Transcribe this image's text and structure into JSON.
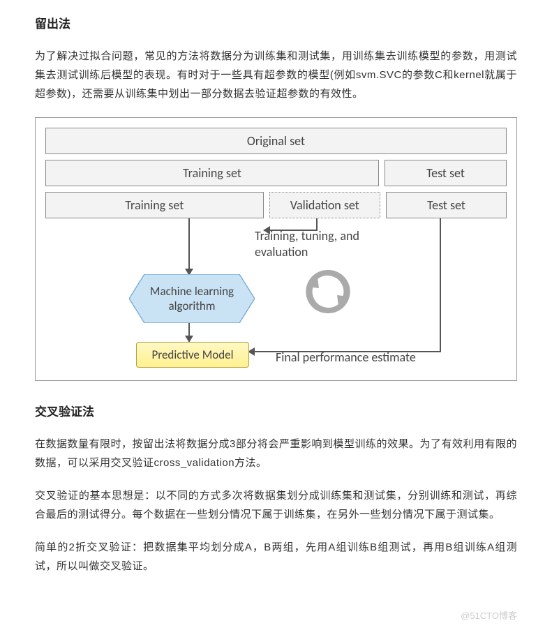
{
  "section1": {
    "title": "留出法",
    "para1": "为了解决过拟合问题，常见的方法将数据分为训练集和测试集，用训练集去训练模型的参数，用测试集去测试训练后模型的表现。有时对于一些具有超参数的模型(例如svm.SVC的参数C和kernel就属于超参数)，还需要从训练集中划出一部分数据去验证超参数的有效性。"
  },
  "figure": {
    "row1": {
      "orig": "Original set"
    },
    "row2": {
      "train": "Training set",
      "test": "Test set"
    },
    "row3": {
      "train": "Training set",
      "val": "Validation set",
      "test": "Test set"
    },
    "tune": "Training, tuning, and\nevaluation",
    "algo": "Machine learning\nalgorithm",
    "pmodel": "Predictive Model",
    "final": "Final performance estimate"
  },
  "section2": {
    "title": "交叉验证法",
    "para1": "在数据数量有限时，按留出法将数据分成3部分将会严重影响到模型训练的效果。为了有效利用有限的数据，可以采用交叉验证cross_validation方法。",
    "para2": "交叉验证的基本思想是：以不同的方式多次将数据集划分成训练集和测试集，分别训练和测试，再综合最后的测试得分。每个数据在一些划分情况下属于训练集，在另外一些划分情况下属于测试集。",
    "para3": "简单的2折交叉验证：把数据集平均划分成A，B两组，先用A组训练B组测试，再用B组训练A组测试，所以叫做交叉验证。"
  },
  "watermark": "@51CTO博客"
}
